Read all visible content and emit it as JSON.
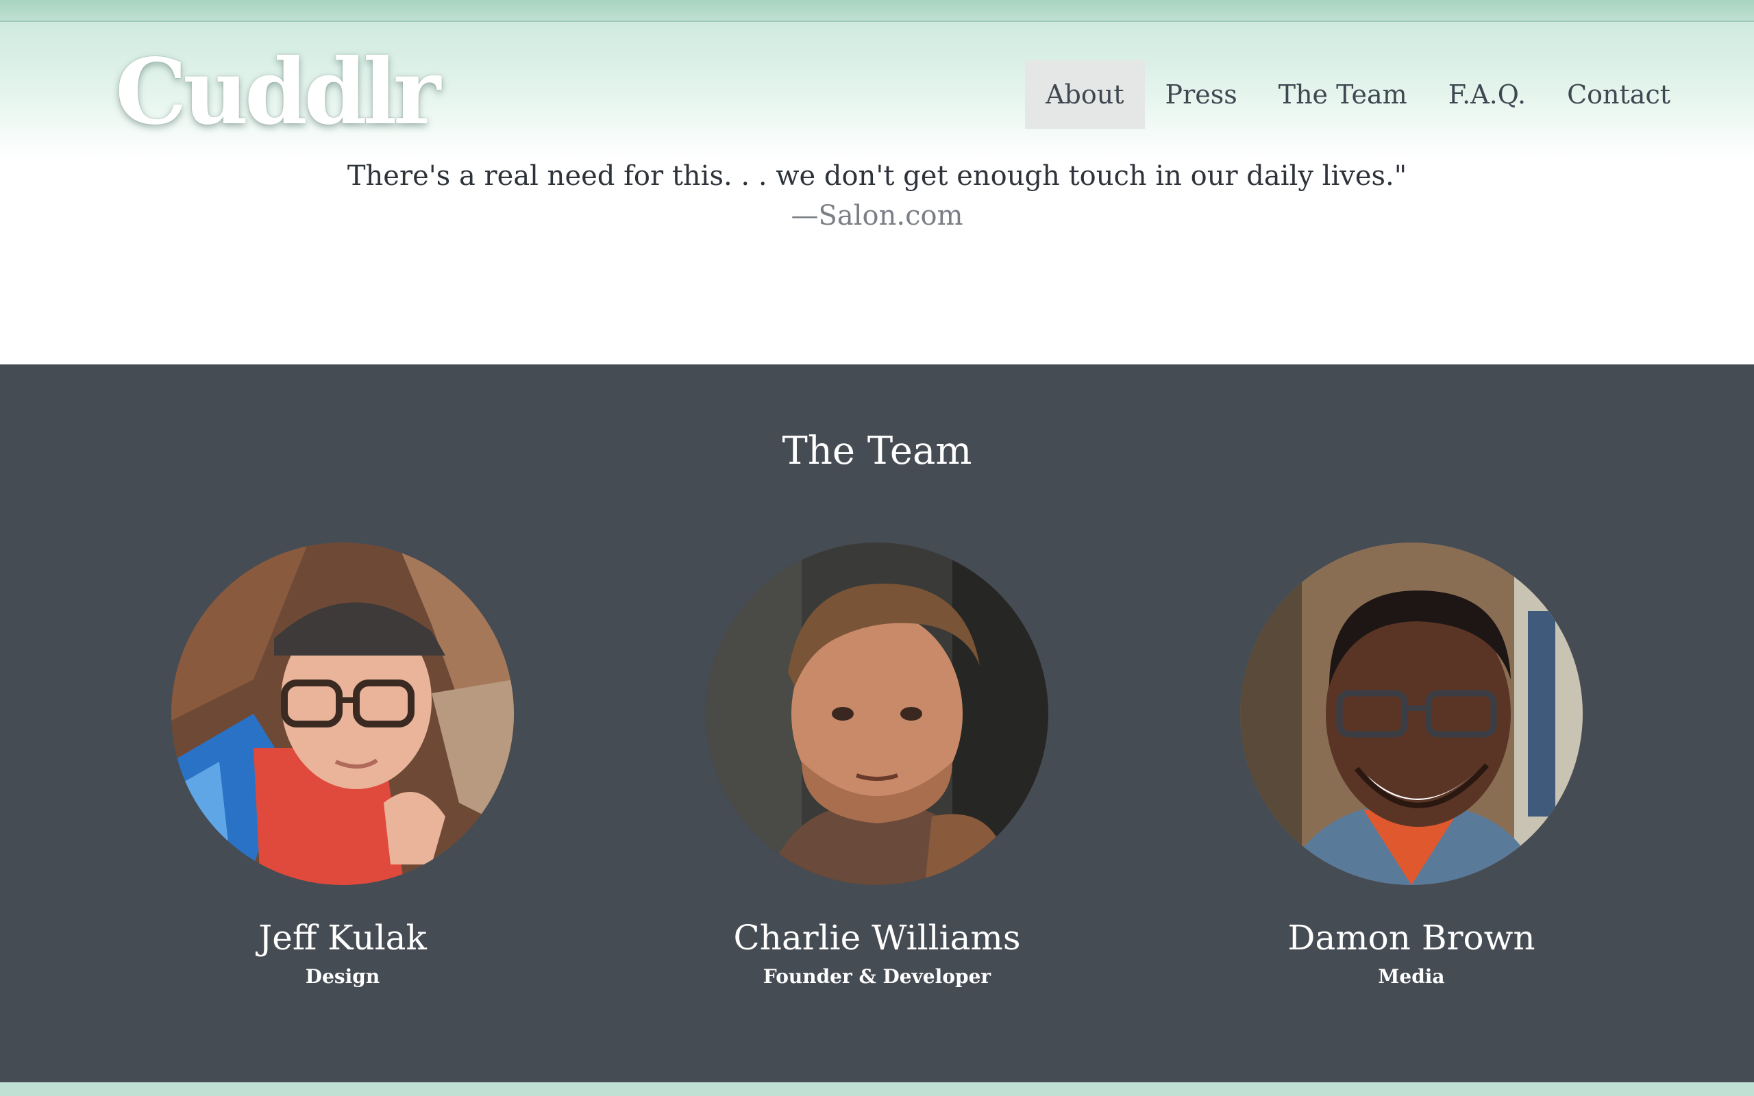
{
  "brand": {
    "logo_text": "Cuddlr"
  },
  "nav": {
    "items": [
      {
        "label": "About",
        "active": true
      },
      {
        "label": "Press",
        "active": false
      },
      {
        "label": "The Team",
        "active": false
      },
      {
        "label": "F.A.Q.",
        "active": false
      },
      {
        "label": "Contact",
        "active": false
      }
    ]
  },
  "quote": {
    "text": "There's a real need for this. . . we don't get enough touch in our daily lives.\"",
    "source": "—Salon.com"
  },
  "team": {
    "title": "The Team",
    "members": [
      {
        "name": "Jeff Kulak",
        "role": "Design"
      },
      {
        "name": "Charlie Williams",
        "role": "Founder & Developer"
      },
      {
        "name": "Damon Brown",
        "role": "Media"
      }
    ]
  },
  "colors": {
    "header_mint": "#cfeadf",
    "team_background": "#464c54",
    "nav_active_background": "#e4e7e6",
    "text_dark": "#2e333a",
    "text_muted": "#7a7f85"
  }
}
